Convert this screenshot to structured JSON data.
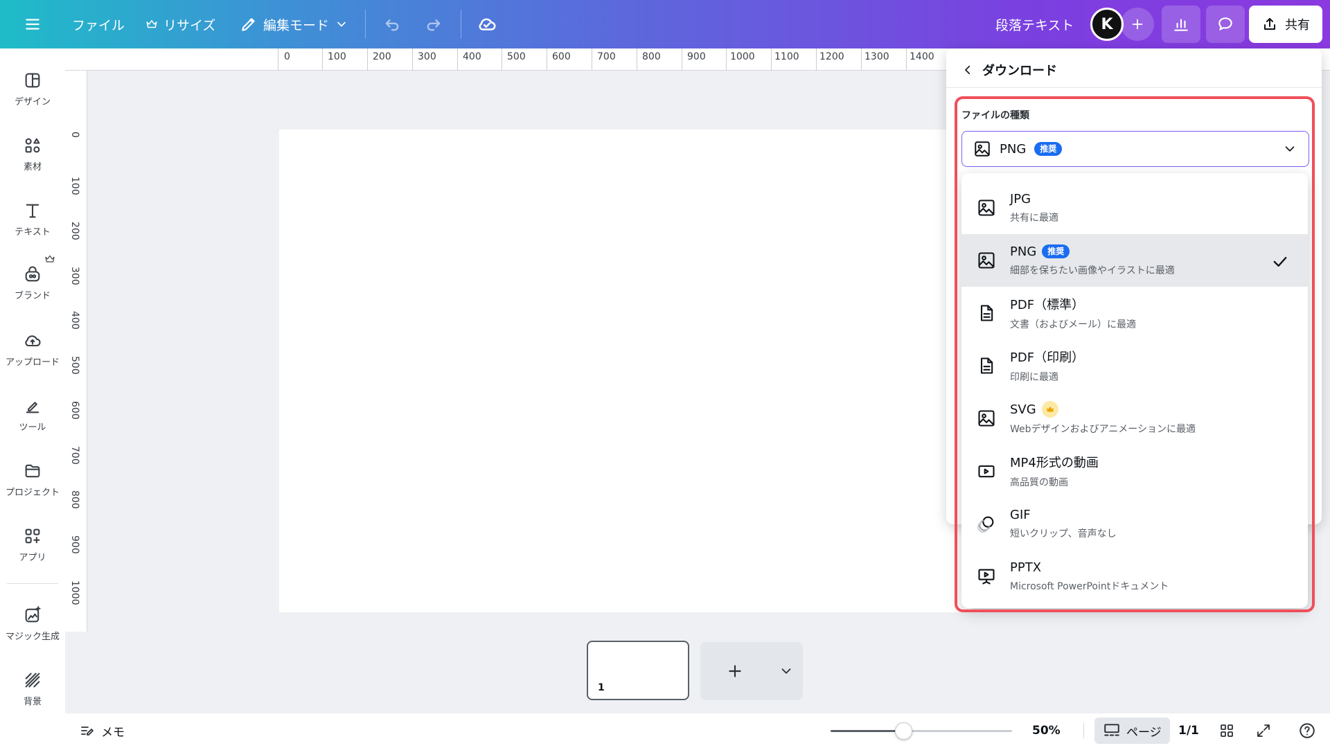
{
  "topbar": {
    "file": "ファイル",
    "resize": "リサイズ",
    "edit_mode": "編集モード",
    "text_style": "段落テキスト",
    "avatar_initial": "K",
    "share": "共有"
  },
  "sidebar": {
    "items": [
      {
        "label": "デザイン",
        "icon": "design-icon"
      },
      {
        "label": "素材",
        "icon": "elements-icon"
      },
      {
        "label": "テキスト",
        "icon": "text-icon"
      },
      {
        "label": "ブランド",
        "icon": "brand-icon"
      },
      {
        "label": "アップロード",
        "icon": "upload-icon"
      },
      {
        "label": "ツール",
        "icon": "tools-icon"
      },
      {
        "label": "プロジェクト",
        "icon": "folder-icon"
      },
      {
        "label": "アプリ",
        "icon": "apps-icon"
      },
      {
        "label": "マジック生成",
        "icon": "magic-icon"
      },
      {
        "label": "背景",
        "icon": "background-icon"
      }
    ]
  },
  "ruler": {
    "top": [
      "0",
      "100",
      "200",
      "300",
      "400",
      "500",
      "600",
      "700",
      "800",
      "900",
      "1000",
      "1100",
      "1200",
      "1300",
      "1400"
    ],
    "left": [
      "0",
      "100",
      "200",
      "300",
      "400",
      "500",
      "600",
      "700",
      "800",
      "900",
      "1000"
    ]
  },
  "pages": {
    "thumb_number": "1"
  },
  "bottombar": {
    "notes": "メモ",
    "zoom": "50%",
    "zoom_level": 0.5,
    "page_view": "ページ",
    "page_count": "1/1"
  },
  "download": {
    "title": "ダウンロード",
    "file_type_label": "ファイルの種類",
    "selected": "PNG",
    "recommended_badge": "推奨",
    "options": [
      {
        "title": "JPG",
        "desc": "共有に最適",
        "icon": "image-icon"
      },
      {
        "title": "PNG",
        "desc": "細部を保ちたい画像やイラストに最適",
        "icon": "image-icon",
        "badge": "推奨",
        "selected": true
      },
      {
        "title": "PDF（標準）",
        "desc": "文書（およびメール）に最適",
        "icon": "document-icon"
      },
      {
        "title": "PDF（印刷）",
        "desc": "印刷に最適",
        "icon": "document-icon"
      },
      {
        "title": "SVG",
        "desc": "Webデザインおよびアニメーションに最適",
        "icon": "image-icon",
        "pro": true
      },
      {
        "title": "MP4形式の動画",
        "desc": "高品質の動画",
        "icon": "video-icon"
      },
      {
        "title": "GIF",
        "desc": "短いクリップ、音声なし",
        "icon": "gif-icon"
      },
      {
        "title": "PPTX",
        "desc": "Microsoft PowerPointドキュメント",
        "icon": "presentation-icon"
      }
    ]
  },
  "colors": {
    "accent": "#7d5cf2",
    "badge": "#1a6cf0",
    "highlight": "#ef4f5a"
  }
}
